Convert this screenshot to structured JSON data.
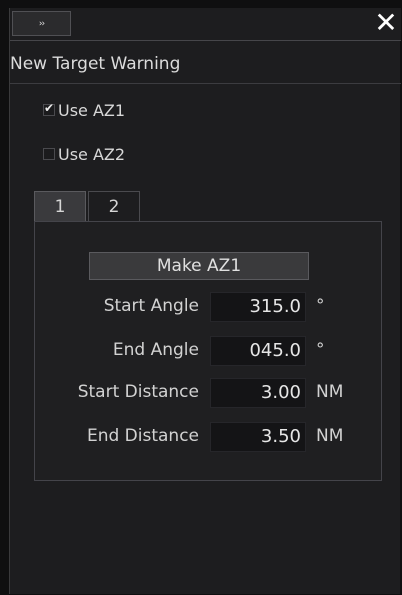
{
  "titlebar": {
    "expand_icon_label": "››",
    "close_icon_label": "✕"
  },
  "header": {
    "title": "New Target Warning"
  },
  "options": {
    "use_az1": {
      "label": "Use AZ1",
      "checked": true
    },
    "use_az2": {
      "label": "Use AZ2",
      "checked": false
    }
  },
  "tabs": [
    {
      "label": "1",
      "active": true
    },
    {
      "label": "2",
      "active": false
    }
  ],
  "make_button": {
    "label": "Make AZ1"
  },
  "fields": {
    "start_angle": {
      "label": "Start Angle",
      "value": "315.0",
      "unit": "°"
    },
    "end_angle": {
      "label": "End Angle",
      "value": "045.0",
      "unit": "°"
    },
    "start_distance": {
      "label": "Start Distance",
      "value": "3.00",
      "unit": "NM"
    },
    "end_distance": {
      "label": "End Distance",
      "value": "3.50",
      "unit": "NM"
    }
  }
}
